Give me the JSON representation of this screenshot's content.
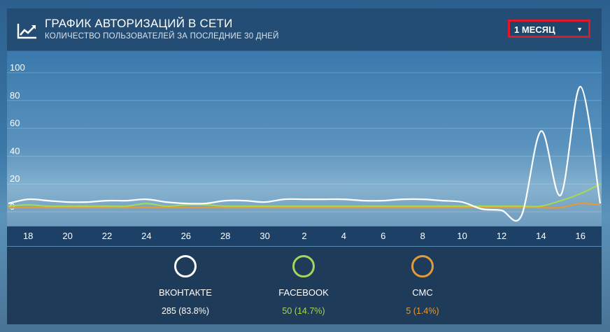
{
  "header": {
    "title": "ГРАФИК АВТОРИЗАЦИЙ В СЕТИ",
    "subtitle": "КОЛИЧЕСТВО ПОЛЬЗОВАТЕЛЕЙ ЗА ПОСЛЕДНИЕ 30 ДНЕЙ",
    "icon": "trending-up-icon",
    "period_label": "1 МЕСЯЦ"
  },
  "chart_data": {
    "type": "line",
    "x": [
      "17",
      "18",
      "19",
      "20",
      "21",
      "22",
      "23",
      "24",
      "25",
      "26",
      "27",
      "28",
      "29",
      "30",
      "1",
      "2",
      "3",
      "4",
      "5",
      "6",
      "7",
      "8",
      "9",
      "10",
      "11",
      "12",
      "13",
      "14",
      "15",
      "16",
      "17"
    ],
    "x_tick_labels": [
      "18",
      "20",
      "22",
      "24",
      "26",
      "28",
      "30",
      "2",
      "4",
      "6",
      "8",
      "10",
      "12",
      "14",
      "16"
    ],
    "y_tick_labels": [
      "100",
      "80",
      "60",
      "40",
      "20",
      "0"
    ],
    "ylim": [
      0,
      100
    ],
    "series": [
      {
        "name": "ВКОНТАКТЕ",
        "color": "#ffffff",
        "values": [
          6,
          9,
          8,
          7,
          7,
          8,
          8,
          9,
          7,
          6,
          6,
          8,
          8,
          7,
          9,
          9,
          9,
          9,
          8,
          8,
          9,
          9,
          8,
          7,
          2,
          1,
          -3,
          58,
          12,
          90,
          6
        ]
      },
      {
        "name": "FACEBOOK",
        "color": "#a3d65c",
        "values": [
          4,
          5,
          4,
          4,
          4,
          4,
          4,
          6,
          4,
          5,
          5,
          4,
          4,
          4,
          4,
          4,
          4,
          4,
          4,
          4,
          4,
          4,
          4,
          4,
          4,
          4,
          4,
          4,
          8,
          13,
          20
        ]
      },
      {
        "name": "СМС",
        "color": "#e29a3a",
        "values": [
          3,
          3,
          3,
          3,
          3,
          3,
          3,
          3,
          3,
          3,
          3,
          3,
          3,
          3,
          3,
          3,
          3,
          3,
          3,
          3,
          3,
          3,
          3,
          3,
          3,
          3,
          3,
          3,
          3,
          6,
          5
        ]
      }
    ]
  },
  "stats": [
    {
      "name": "ВКОНТАКТЕ",
      "value": "285 (83.8%)",
      "color": "#ffffff"
    },
    {
      "name": "FACEBOOK",
      "value": "50 (14.7%)",
      "color": "#a3d65c"
    },
    {
      "name": "СМС",
      "value": "5 (1.4%)",
      "color": "#e29a3a"
    }
  ]
}
